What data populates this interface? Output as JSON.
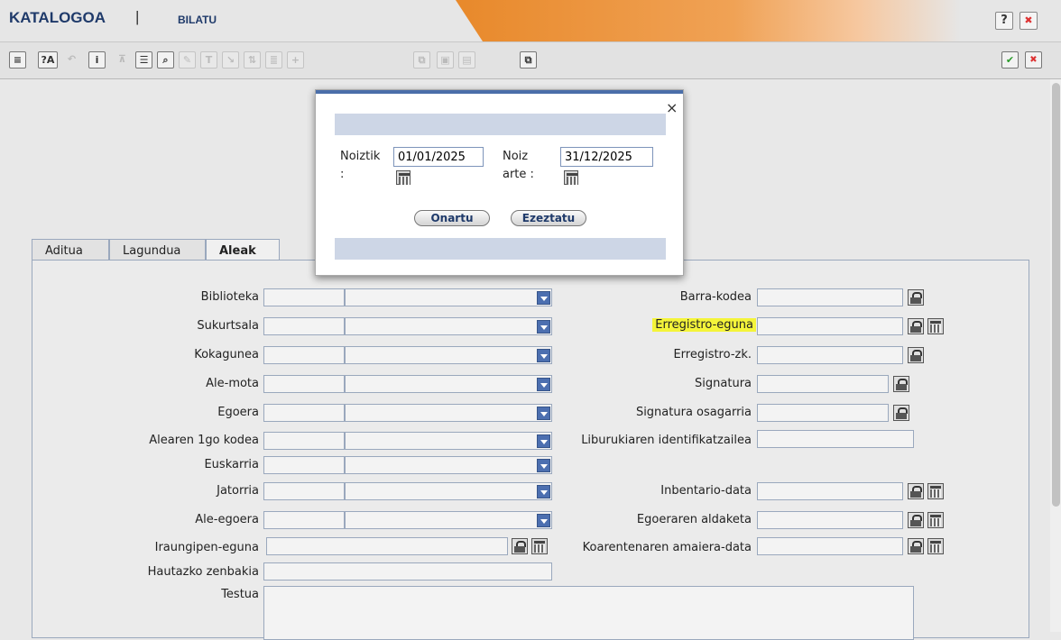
{
  "header": {
    "title": "KATALOGOA",
    "separator": "|",
    "subtitle": "BILATU",
    "help_label": "?",
    "close_label": "✖"
  },
  "toolbar": {
    "icons": [
      "menu-icon",
      "lang-icon",
      "back-icon",
      "info-icon",
      "filter-icon",
      "form-icon",
      "search-doc-icon",
      "edit-icon",
      "text-icon",
      "arrow-icon",
      "sort-icon",
      "list-icon",
      "add-icon",
      "copy-icon",
      "paste-icon",
      "export-icon",
      "duplicate-icon"
    ],
    "lang_label": "?A",
    "info_label": "i",
    "accept_label": "✔",
    "cancel_label": "✖"
  },
  "tabs": [
    {
      "label": "Aditua"
    },
    {
      "label": "Lagundua"
    },
    {
      "label": "Aleak",
      "active": true
    }
  ],
  "left_fields": [
    {
      "label": "Biblioteka"
    },
    {
      "label": "Sukurtsala"
    },
    {
      "label": "Kokagunea"
    },
    {
      "label": "Ale-mota"
    },
    {
      "label": "Egoera"
    },
    {
      "label": "Alearen 1go kodea"
    },
    {
      "label": "Euskarria"
    },
    {
      "label": "Jatorria"
    },
    {
      "label": "Ale-egoera"
    },
    {
      "label": "Iraungipen-eguna"
    },
    {
      "label": "Hautazko zenbakia"
    },
    {
      "label": "Testua"
    }
  ],
  "right_fields": [
    {
      "label": "Barra-kodea"
    },
    {
      "label": "Erregistro-eguna",
      "highlighted": true
    },
    {
      "label": "Erregistro-zk."
    },
    {
      "label": "Signatura"
    },
    {
      "label": "Signatura osagarria"
    },
    {
      "label": "Liburukiaren identifikatzailea"
    },
    {
      "label": "Inbentario-data"
    },
    {
      "label": "Egoeraren aldaketa"
    },
    {
      "label": "Koarentenaren amaiera-data"
    }
  ],
  "modal": {
    "close_label": "×",
    "from_label": "Noiztik",
    "from_colon": ":",
    "from_value": "01/01/2025",
    "to_label_1": "Noiz",
    "to_label_2": "arte :",
    "to_value": "31/12/2025",
    "accept_label": "Onartu",
    "cancel_label": "Ezeztatu"
  },
  "colors": {
    "accent_orange": "#e8892b",
    "title_blue": "#1f3a6a",
    "highlight_yellow": "#f4f43a",
    "dropdown_blue": "#4c6fb0"
  }
}
